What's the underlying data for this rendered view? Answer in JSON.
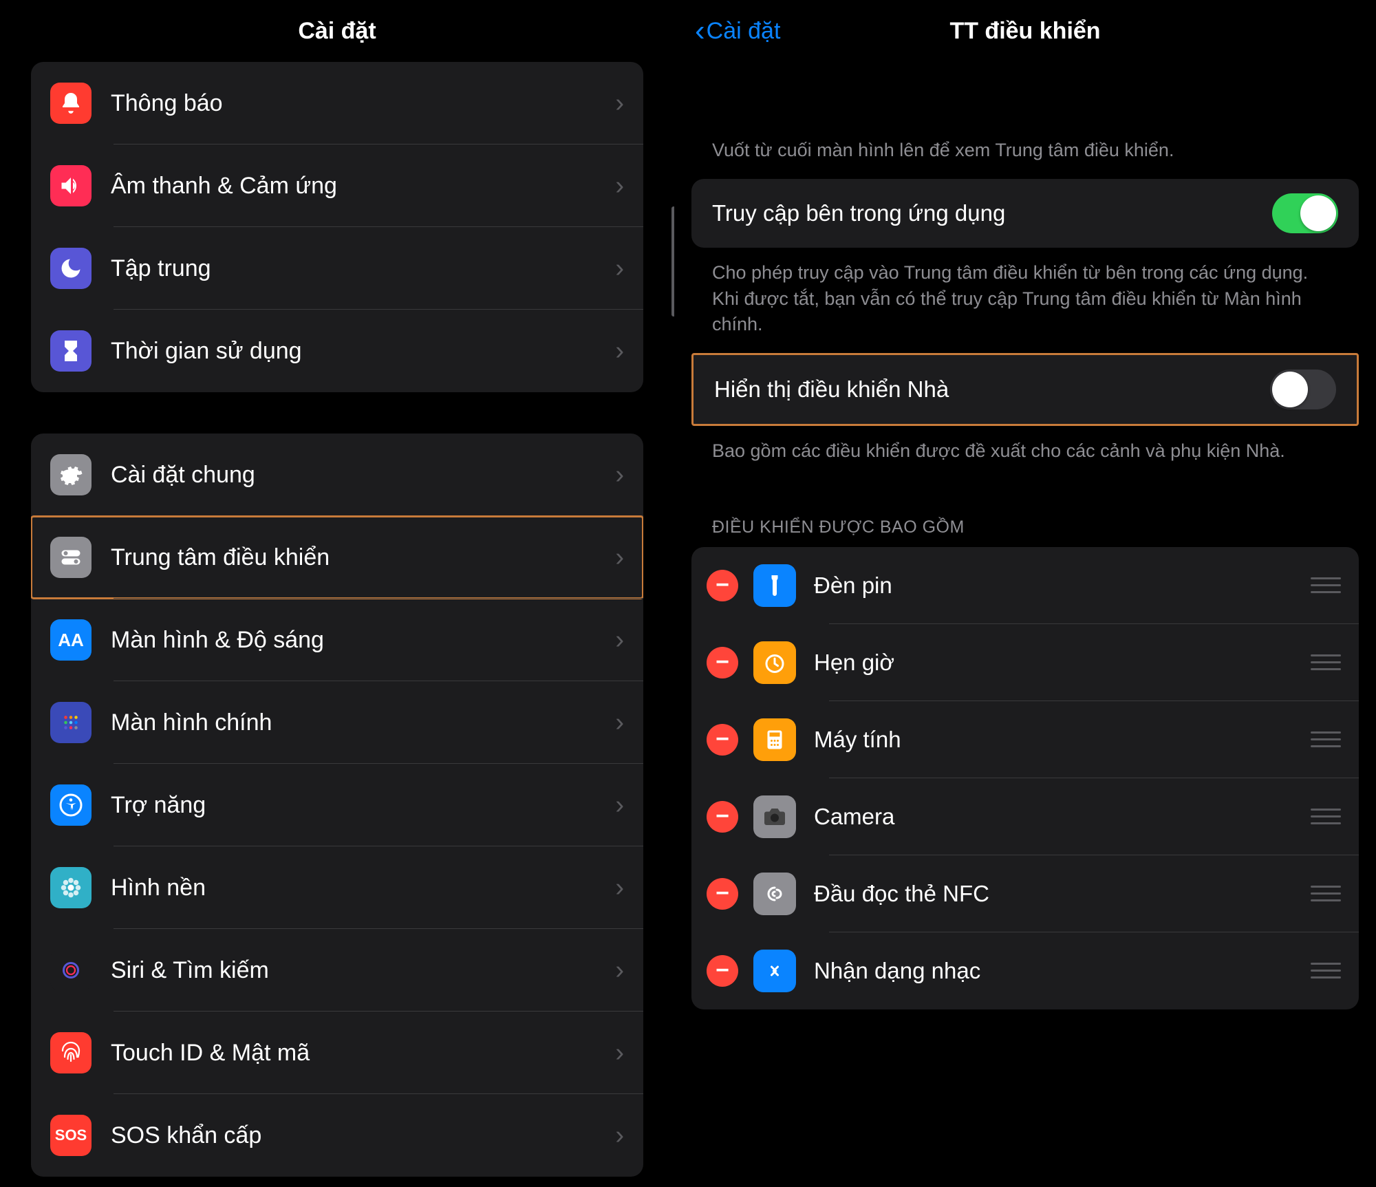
{
  "left": {
    "title": "Cài đặt",
    "group1": [
      {
        "label": "Thông báo",
        "iconBg": "#ff3b30",
        "glyph": "bell"
      },
      {
        "label": "Âm thanh & Cảm ứng",
        "iconBg": "#ff2d55",
        "glyph": "volume"
      },
      {
        "label": "Tập trung",
        "iconBg": "#5856d6",
        "glyph": "moon"
      },
      {
        "label": "Thời gian sử dụng",
        "iconBg": "#5856d6",
        "glyph": "hourglass"
      }
    ],
    "group2": [
      {
        "label": "Cài đặt chung",
        "iconBg": "#8e8e93",
        "glyph": "gear"
      },
      {
        "label": "Trung tâm điều khiển",
        "iconBg": "#8e8e93",
        "glyph": "toggles",
        "highlight": true
      },
      {
        "label": "Màn hình & Độ sáng",
        "iconBg": "#0a84ff",
        "glyph": "text"
      },
      {
        "label": "Màn hình chính",
        "iconBg": "#3a4ab8",
        "glyph": "grid"
      },
      {
        "label": "Trợ năng",
        "iconBg": "#0a84ff",
        "glyph": "accessibility"
      },
      {
        "label": "Hình nền",
        "iconBg": "#30b0c7",
        "glyph": "flower"
      },
      {
        "label": "Siri & Tìm kiếm",
        "iconBg": "#1c1c1e",
        "glyph": "siri"
      },
      {
        "label": "Touch ID & Mật mã",
        "iconBg": "#ff3b30",
        "glyph": "fingerprint"
      },
      {
        "label": "SOS khẩn cấp",
        "iconBg": "#ff3b30",
        "glyph": "sos"
      }
    ]
  },
  "right": {
    "back": "Cài đặt",
    "title": "TT điều khiển",
    "caption1": "Vuốt từ cuối màn hình lên để xem Trung tâm điều khiển.",
    "switch1": {
      "label": "Truy cập bên trong ứng dụng",
      "on": true
    },
    "caption2": "Cho phép truy cập vào Trung tâm điều khiển từ bên trong các ứng dụng. Khi được tắt, bạn vẫn có thể truy cập Trung tâm điều khiển từ Màn hình chính.",
    "switch2": {
      "label": "Hiển thị điều khiển Nhà",
      "on": false
    },
    "caption3": "Bao gồm các điều khiển được đề xuất cho các cảnh và phụ kiện Nhà.",
    "section": "ĐIỀU KHIỂN ĐƯỢC BAO GỒM",
    "controls": [
      {
        "label": "Đèn pin",
        "iconBg": "#0a84ff",
        "glyph": "flashlight"
      },
      {
        "label": "Hẹn giờ",
        "iconBg": "#ff9f0a",
        "glyph": "timer"
      },
      {
        "label": "Máy tính",
        "iconBg": "#ff9f0a",
        "glyph": "calculator"
      },
      {
        "label": "Camera",
        "iconBg": "#8e8e93",
        "glyph": "camera"
      },
      {
        "label": "Đầu đọc thẻ NFC",
        "iconBg": "#8e8e93",
        "glyph": "nfc"
      },
      {
        "label": "Nhận dạng nhạc",
        "iconBg": "#0a84ff",
        "glyph": "shazam"
      }
    ]
  }
}
